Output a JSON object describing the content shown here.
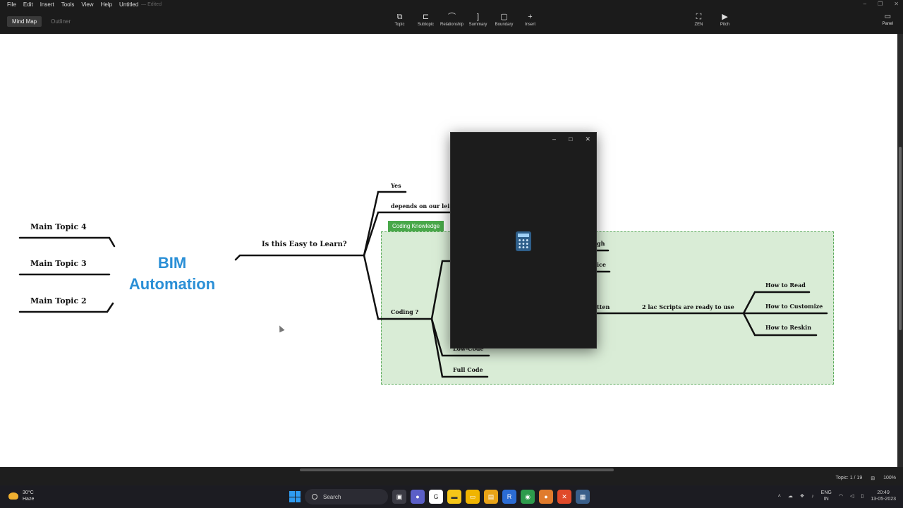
{
  "menu": {
    "items": [
      "File",
      "Edit",
      "Insert",
      "Tools",
      "View",
      "Help"
    ],
    "document_title": "Untitled",
    "edited": "— Edited"
  },
  "view_tabs": [
    "Mind Map",
    "Outliner"
  ],
  "toolbar": [
    {
      "label": "Topic",
      "icon": "topic-icon"
    },
    {
      "label": "Subtopic",
      "icon": "subtopic-icon"
    },
    {
      "label": "Relationship",
      "icon": "relationship-icon"
    },
    {
      "label": "Summary",
      "icon": "summary-icon"
    },
    {
      "label": "Boundary",
      "icon": "boundary-icon"
    },
    {
      "label": "Insert",
      "icon": "plus-icon"
    }
  ],
  "toolbar_right": [
    {
      "label": "ZEN",
      "icon": "zen-icon"
    },
    {
      "label": "Pitch",
      "icon": "pitch-icon"
    }
  ],
  "panel_label": "Panel",
  "mindmap": {
    "central_topic": [
      "BIM",
      "Automation"
    ],
    "left_topics": [
      "Main Topic 4",
      "Main Topic 3",
      "Main Topic 2"
    ],
    "main_branch": "Is this Easy to Learn?",
    "answers": [
      "Yes",
      "depends on our lei"
    ],
    "boundary_label": "Coding Knowledge",
    "coding": "Coding ?",
    "coding_children": [
      "Low-Code",
      "Full Code"
    ],
    "partial_labels": [
      "gh",
      "ice",
      "tten"
    ],
    "scripts": "2 lac Scripts are ready to use",
    "script_children": [
      "How to Read",
      "How to Customize",
      "How to Reskin"
    ]
  },
  "status": {
    "topic_count": "Topic: 1 / 19",
    "zoom": "100%"
  },
  "taskbar": {
    "temperature": "30°C",
    "weather": "Haze",
    "search_placeholder": "Search",
    "lang": "ENG",
    "region": "IN",
    "time": "20:49",
    "date": "13-05-2023"
  },
  "colors": {
    "central_topic": "#2a8fd6",
    "boundary_fill": "#d9ecd6",
    "boundary_label": "#49a84a",
    "branch_lines": "#1b2a1f"
  }
}
